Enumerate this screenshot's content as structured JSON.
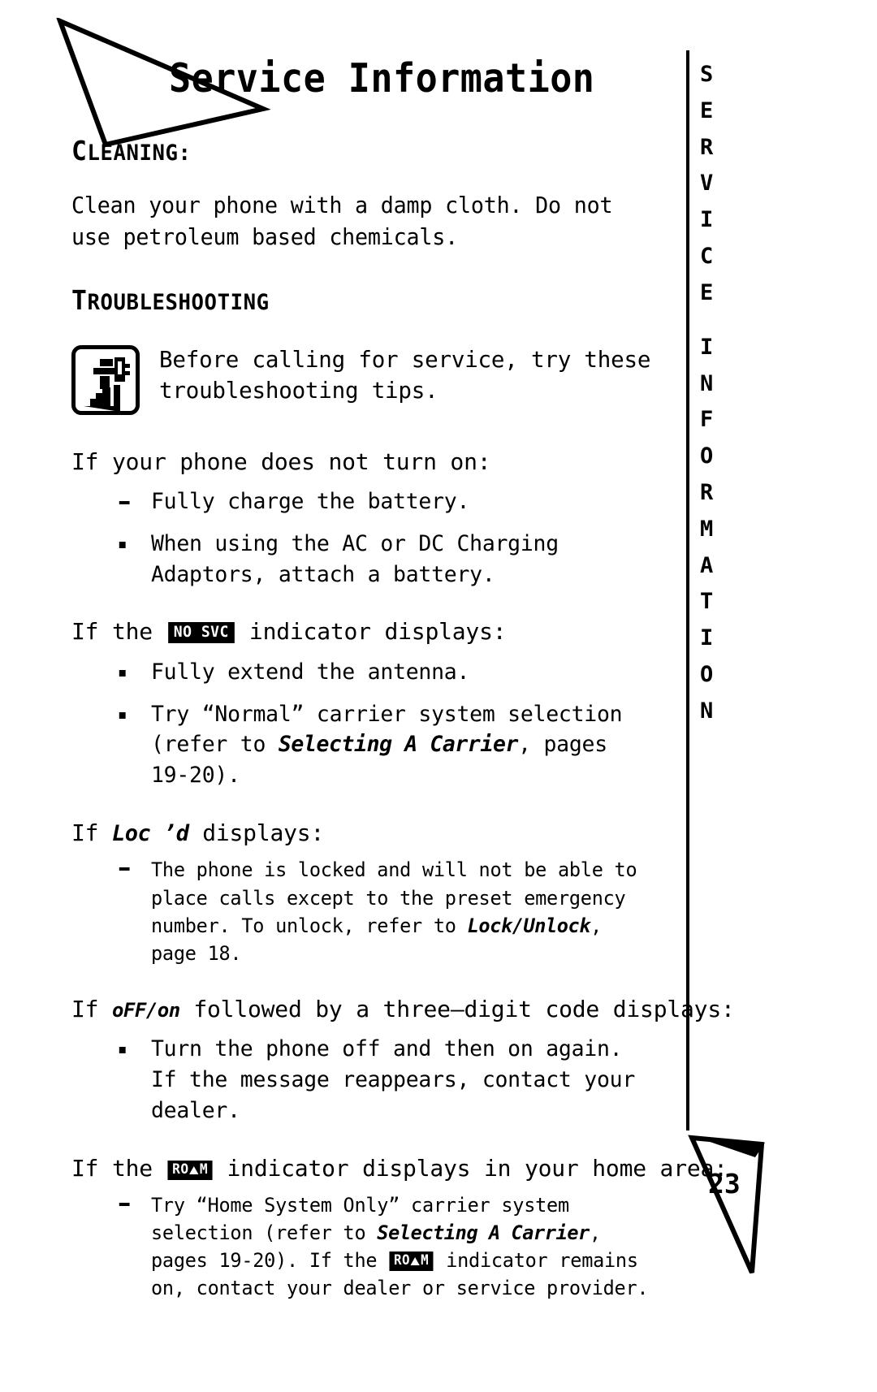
{
  "page": {
    "title": "Service Information",
    "number": "23",
    "side_tab_text": "SERVICE INFORMATION",
    "side_tab_lines": [
      "S",
      "E",
      "R",
      "V",
      "I",
      "C",
      "E",
      "",
      "I",
      "N",
      "F",
      "O",
      "R",
      "M",
      "A",
      "T",
      "I",
      "O",
      "N"
    ]
  },
  "sections": [
    {
      "id": "cleaning",
      "heading_first": "C",
      "heading_rest": "LEANING",
      "heading_suffix": ":",
      "body": "Clean your phone with a damp cloth. Do not use petroleum based chemicals."
    },
    {
      "id": "troubleshooting",
      "heading_first": "T",
      "heading_rest": "ROUBLESHOOTING",
      "heading_suffix": "",
      "tip_icon_name": "hand-with-tool-icon",
      "tip_text": "Before calling for service, try these troubleshooting tips."
    }
  ],
  "problems": [
    {
      "id": "no-power",
      "q_prefix": "If your phone does not turn on:",
      "q_chip": null,
      "q_suffix": "",
      "bullets": [
        {
          "marker": "dash",
          "parts": [
            {
              "t": "Fully charge the battery."
            }
          ]
        },
        {
          "marker": "dot",
          "parts": [
            {
              "t": "When using the AC or DC Charging Adaptors, attach a battery."
            }
          ]
        }
      ]
    },
    {
      "id": "no-svc",
      "q_prefix": "If the ",
      "q_chip": {
        "label": "NO SVC",
        "style": "text"
      },
      "q_suffix": " indicator displays:",
      "bullets": [
        {
          "marker": "dot",
          "parts": [
            {
              "t": "Fully extend the antenna."
            }
          ]
        },
        {
          "marker": "dot",
          "parts": [
            {
              "t": "Try “Normal” carrier system selection (refer to "
            },
            {
              "t": "Selecting A Carrier",
              "style": "bold-italic"
            },
            {
              "t": ", pages 19-20)."
            }
          ]
        }
      ]
    },
    {
      "id": "locd",
      "q_prefix": "If ",
      "q_lcd": "Loc ’d",
      "q_suffix": " displays:",
      "bullets": [
        {
          "marker": "dash",
          "size": "small",
          "parts": [
            {
              "t": "The phone is locked and will not be able to place calls except to the preset emergency number. To unlock, refer to "
            },
            {
              "t": "Lock/Unlock",
              "style": "bold-italic"
            },
            {
              "t": ", page 18."
            }
          ]
        }
      ]
    },
    {
      "id": "offon",
      "q_prefix": "If ",
      "q_lcd": "oFF/on",
      "q_suffix": " followed by a three–digit code displays:",
      "bullets": [
        {
          "marker": "dot",
          "parts": [
            {
              "t": "Turn the phone off and then on again. If the message reappears, contact your dealer."
            }
          ]
        }
      ]
    },
    {
      "id": "roam",
      "q_prefix": "If the ",
      "q_chip": {
        "label": "ROAM",
        "style": "triangle"
      },
      "q_suffix": " indicator displays in your home area:",
      "bullets": [
        {
          "marker": "dash",
          "parts": [
            {
              "t": "Try “Home System Only” carrier system selection (refer to "
            },
            {
              "t": "Selecting A Carrier",
              "style": "bold-italic"
            },
            {
              "t": ", pages 19-20). If the "
            },
            {
              "t": "ROAM",
              "style": "chip-triangle"
            },
            {
              "t": " indicator remains on, contact your dealer or service provider."
            }
          ]
        }
      ]
    }
  ],
  "colors": {
    "ink": "#000000",
    "paper": "#ffffff"
  }
}
